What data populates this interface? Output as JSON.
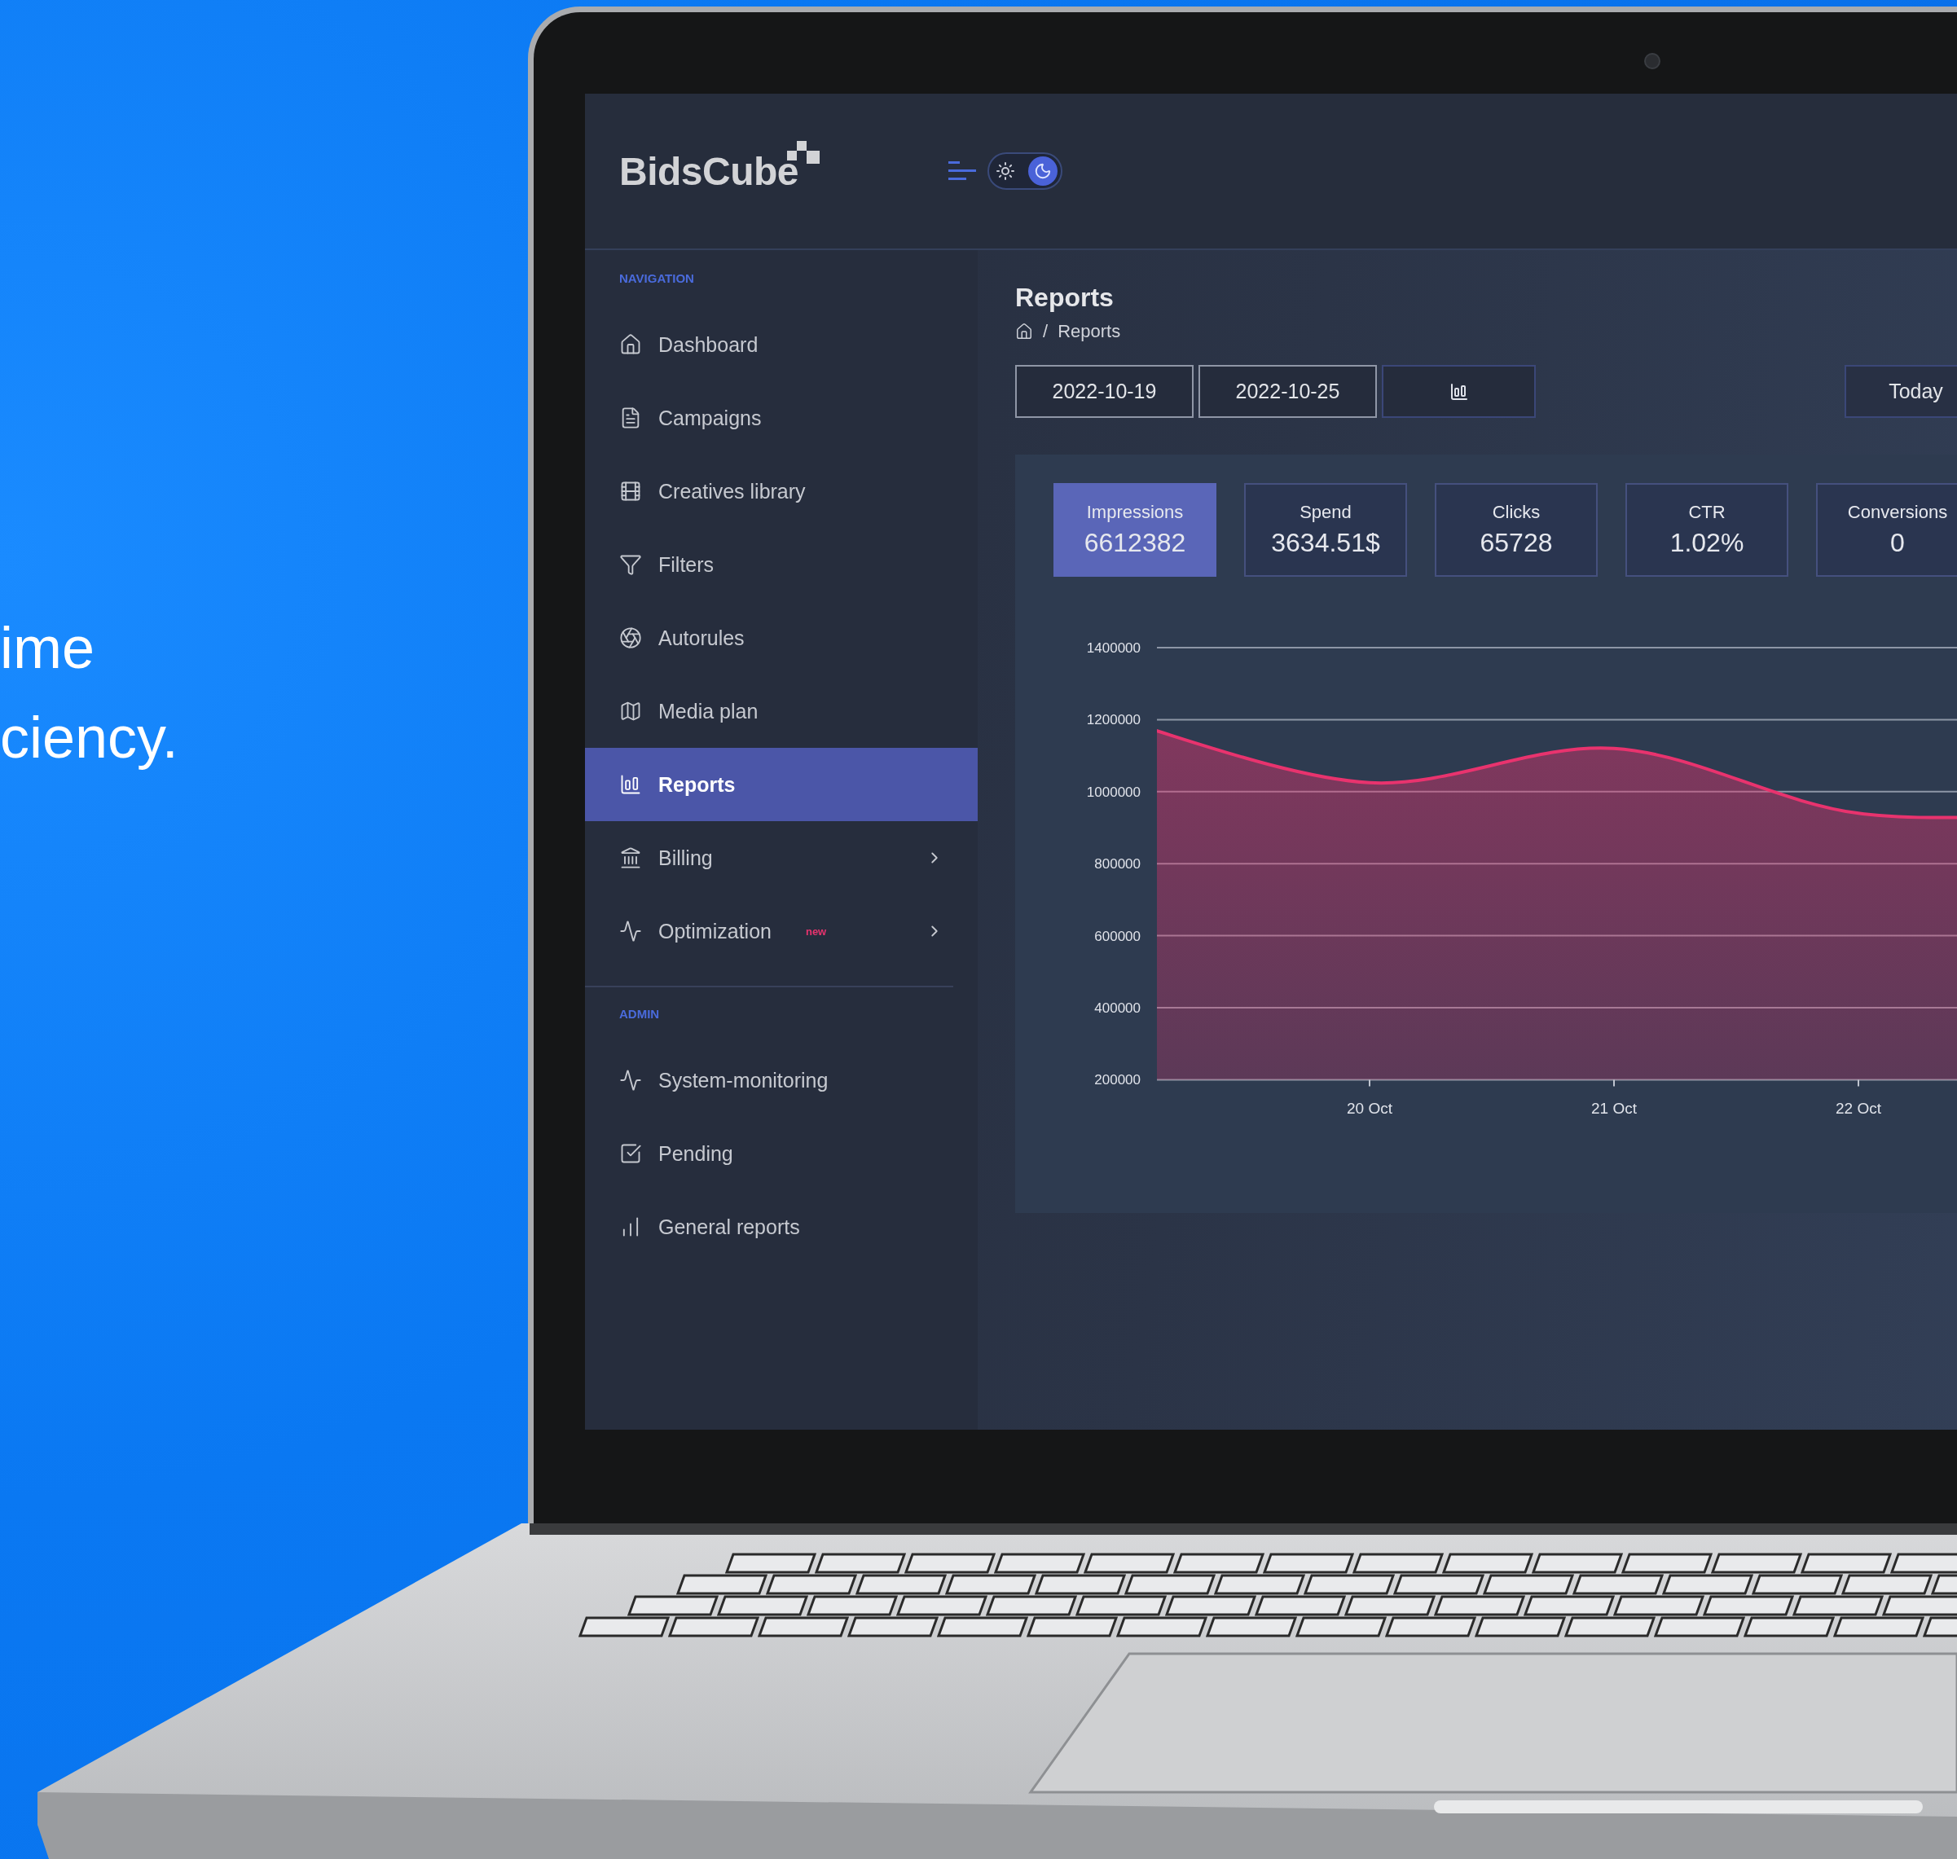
{
  "marketing_text": [
    "ime",
    "ciency."
  ],
  "app": {
    "logo": "BidsCube",
    "dark_mode": true,
    "sidebar": {
      "sections": [
        {
          "title": "NAVIGATION",
          "items": [
            {
              "label": "Dashboard",
              "selected": false,
              "has_submenu": false
            },
            {
              "label": "Campaigns",
              "selected": false,
              "has_submenu": false
            },
            {
              "label": "Creatives library",
              "selected": false,
              "has_submenu": false
            },
            {
              "label": "Filters",
              "selected": false,
              "has_submenu": false
            },
            {
              "label": "Autorules",
              "selected": false,
              "has_submenu": false
            },
            {
              "label": "Media plan",
              "selected": false,
              "has_submenu": false
            },
            {
              "label": "Reports",
              "selected": true,
              "has_submenu": false
            },
            {
              "label": "Billing",
              "selected": false,
              "has_submenu": true
            },
            {
              "label": "Optimization",
              "selected": false,
              "has_submenu": true,
              "badge": "new"
            }
          ]
        },
        {
          "title": "ADMIN",
          "items": [
            {
              "label": "System-monitoring",
              "selected": false,
              "has_submenu": false
            },
            {
              "label": "Pending",
              "selected": false,
              "has_submenu": false
            },
            {
              "label": "General reports",
              "selected": false,
              "has_submenu": false
            }
          ]
        }
      ]
    },
    "page": {
      "title": "Reports",
      "breadcrumb": {
        "separator": "/",
        "current": "Reports"
      },
      "toolbar": {
        "start_date": "2022-10-19",
        "end_date": "2022-10-25",
        "range_button": "Today"
      },
      "stats": [
        {
          "label": "Impressions",
          "value": "6612382",
          "selected": true
        },
        {
          "label": "Spend",
          "value": "3634.51$",
          "selected": false
        },
        {
          "label": "Clicks",
          "value": "65728",
          "selected": false
        },
        {
          "label": "CTR",
          "value": "1.02%",
          "selected": false
        },
        {
          "label": "Conversions",
          "value": "0",
          "selected": false
        }
      ],
      "chart_data": {
        "type": "area",
        "categories": [
          null,
          "20 Oct",
          "21 Oct",
          "22 Oct",
          null
        ],
        "series": [
          {
            "color": "#e8336e",
            "values": [
              1195000,
              1025000,
              1120000,
              940000,
              945000
            ]
          }
        ],
        "ylim": [
          200000,
          1400000
        ],
        "grid": true,
        "yticks": [
          {
            "value": 1400000,
            "label": "1400000"
          },
          {
            "value": 1200000,
            "label": "1200000"
          },
          {
            "value": 1000000,
            "label": "1000000"
          },
          {
            "value": 800000,
            "label": "800000"
          },
          {
            "value": 600000,
            "label": "600000"
          },
          {
            "value": 400000,
            "label": "400000"
          },
          {
            "value": 200000,
            "label": "200000"
          }
        ]
      }
    }
  }
}
